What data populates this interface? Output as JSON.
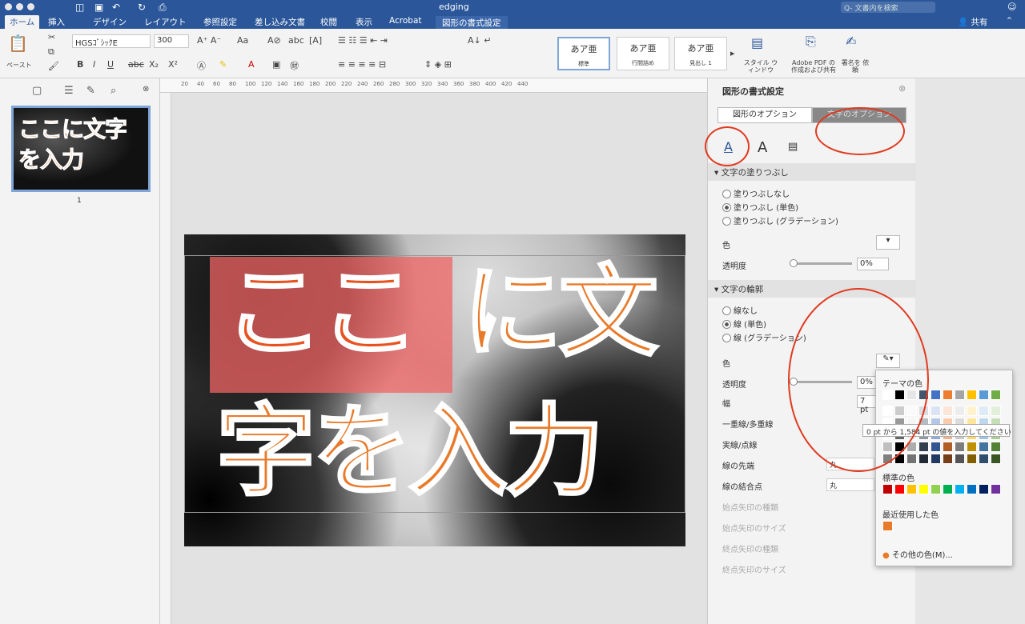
{
  "window": {
    "title": "edging",
    "search_placeholder": "Q- 文書内を検索",
    "share_label": "共有"
  },
  "tabs": [
    {
      "label": "ホーム"
    },
    {
      "label": "挿入"
    },
    {
      "label": "デザイン"
    },
    {
      "label": "レイアウト"
    },
    {
      "label": "参照設定"
    },
    {
      "label": "差し込み文書"
    },
    {
      "label": "校閲"
    },
    {
      "label": "表示"
    },
    {
      "label": "Acrobat"
    },
    {
      "label": "図形の書式設定"
    }
  ],
  "ribbon": {
    "paste_label": "ペースト",
    "font_name": "HGSｺﾞｼｯｸE",
    "font_size": "300",
    "styles": [
      {
        "sample": "あア亜",
        "name": "標準"
      },
      {
        "sample": "あア亜",
        "name": "行間詰め"
      },
      {
        "sample": "あア亜",
        "name": "見出し 1"
      }
    ],
    "style_window_label": "スタイル ウィンドウ",
    "adobe_pdf_label": "Adobe PDF の 作成および共有",
    "sign_label": "署名を 依頼"
  },
  "sidebar": {
    "page_number": "1",
    "thumb_text": "ここに文字を入力"
  },
  "ruler": {
    "ticks": [
      "20",
      "40",
      "60",
      "80",
      "100",
      "120",
      "140",
      "160",
      "180",
      "200",
      "220",
      "240",
      "260",
      "280",
      "300",
      "320",
      "340",
      "360",
      "380",
      "400",
      "420",
      "440"
    ]
  },
  "slide": {
    "line1_highlight": "ここ",
    "line1_rest": "に文",
    "line2": "字を入力"
  },
  "panel": {
    "title": "図形の書式設定",
    "tab_shape": "図形のオプション",
    "tab_text": "文字のオプション",
    "fill_section": "文字の塗りつぶし",
    "fill_options": [
      "塗りつぶしなし",
      "塗りつぶし (単色)",
      "塗りつぶし (グラデーション)"
    ],
    "fill_selected_index": 1,
    "color_label": "色",
    "transparency_label": "透明度",
    "transparency_value": "0%",
    "outline_section": "文字の輪郭",
    "outline_options": [
      "線なし",
      "線 (単色)",
      "線 (グラデーション)"
    ],
    "outline_selected_index": 1,
    "outline_color_label": "色",
    "outline_transparency_label": "透明度",
    "outline_transparency_value": "0%",
    "width_label": "幅",
    "width_value": "7 pt",
    "compound_label": "一重線/多重線",
    "dash_label": "実線/点線",
    "cap_label": "線の先端",
    "cap_value": "丸",
    "join_label": "線の結合点",
    "join_value": "丸",
    "begin_arrow_type": "始点矢印の種類",
    "begin_arrow_size": "始点矢印のサイズ",
    "end_arrow_type": "終点矢印の種類",
    "end_arrow_size": "終点矢印のサイズ"
  },
  "color_popup": {
    "theme_label": "テーマの色",
    "standard_label": "標準の色",
    "recent_label": "最近使用した色",
    "more_colors": "その他の色(M)...",
    "tooltip": "0 pt から 1,584 pt の値を入力してください",
    "theme_colors": [
      "#ffffff",
      "#000000",
      "#e7e6e6",
      "#44546a",
      "#4472c4",
      "#ed7d31",
      "#a5a5a5",
      "#ffc000",
      "#5b9bd5",
      "#70ad47"
    ],
    "standard_colors": [
      "#c00000",
      "#ff0000",
      "#ffc000",
      "#ffff00",
      "#92d050",
      "#00b050",
      "#00b0f0",
      "#0070c0",
      "#002060",
      "#7030a0"
    ],
    "recent_colors": [
      "#e87a2a"
    ]
  },
  "colors": {
    "accent": "#2b579a",
    "highlight_text": "#e8521f",
    "text_orange": "#e87a2a",
    "annotation_red": "#e03a1f"
  }
}
